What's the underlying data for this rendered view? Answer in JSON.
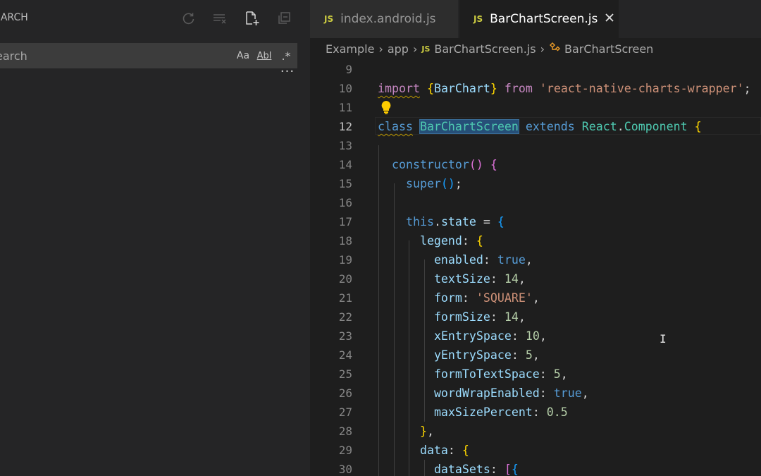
{
  "sidebar": {
    "title": "EARCH",
    "search_placeholder": "earch",
    "options": {
      "match_case": "Aa",
      "whole_word": "Abl",
      "regex": ".*"
    },
    "more": "···"
  },
  "tabs": [
    {
      "label": "index.android.js",
      "badge": "JS",
      "active": false
    },
    {
      "label": "BarChartScreen.js",
      "badge": "JS",
      "active": true
    }
  ],
  "breadcrumb": {
    "items": [
      "Example",
      "app",
      "BarChartScreen.js",
      "BarChartScreen"
    ],
    "badge": "JS"
  },
  "editor": {
    "current_line": 12,
    "line_numbers": [
      "9",
      "10",
      "11",
      "12",
      "13",
      "14",
      "15",
      "16",
      "17",
      "18",
      "19",
      "20",
      "21",
      "22",
      "23",
      "24",
      "25",
      "26",
      "27",
      "28",
      "29",
      "30"
    ],
    "lines": [
      "",
      "import {BarChart} from 'react-native-charts-wrapper';",
      "",
      "class BarChartScreen extends React.Component {",
      "",
      "  constructor() {",
      "    super();",
      "",
      "    this.state = {",
      "      legend: {",
      "        enabled: true,",
      "        textSize: 14,",
      "        form: 'SQUARE',",
      "        formSize: 14,",
      "        xEntrySpace: 10,",
      "        yEntrySpace: 5,",
      "        formToTextSpace: 5,",
      "        wordWrapEnabled: true,",
      "        maxSizePercent: 0.5",
      "      },",
      "      data: {",
      "        dataSets: [{"
    ]
  },
  "colors": {
    "editor_bg": "#1e1e1e",
    "sidebar_bg": "#252526",
    "keyword": "#c586c0",
    "storage": "#569cd6",
    "function": "#dcdcaa",
    "class": "#4ec9b0",
    "property": "#9cdcfe",
    "string": "#ce9178",
    "number": "#b5cea8",
    "js_badge": "#cbcb41"
  },
  "icons": [
    "refresh-icon",
    "clear-results-icon",
    "new-search-editor-icon",
    "collapse-all-icon",
    "close-icon",
    "lightbulb-icon",
    "symbol-class-icon"
  ]
}
